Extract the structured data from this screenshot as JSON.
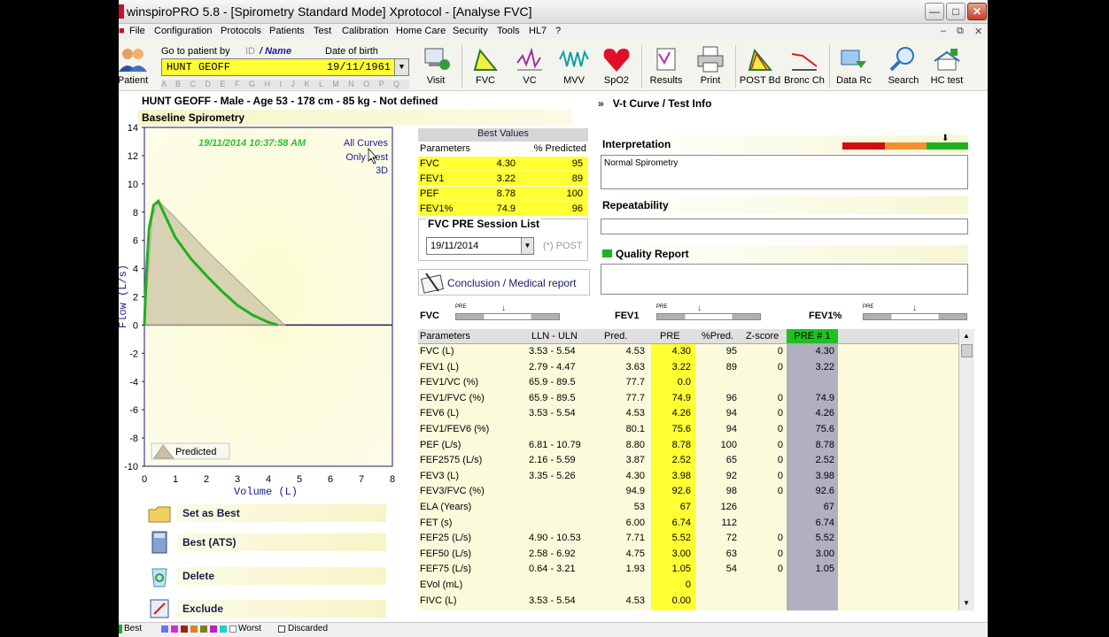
{
  "window": {
    "title": "winspiroPRO 5.8 - [Spirometry Standard Mode] Xprotocol - [Analyse FVC]"
  },
  "menu": [
    "File",
    "Configuration",
    "Protocols",
    "Patients",
    "Test",
    "Calibration",
    "Home Care",
    "Security",
    "Tools",
    "HL7",
    "?"
  ],
  "toolbar": {
    "patient_label": "Patient",
    "goto_label": "Go to patient by",
    "id_label": "ID",
    "name_label": "/ Name",
    "dob_label": "Date of birth",
    "patient_name": "HUNT GEOFF",
    "patient_dob": "19/11/1961",
    "alphabet": "A B C D E F G H I J K L M N O P Q R S T U V W X Y Z",
    "buttons": [
      "Visit",
      "FVC",
      "VC",
      "MVV",
      "SpO2",
      "Results",
      "Print",
      "POST Bd",
      "Bronc Ch",
      "Data Rc",
      "Search",
      "HC test"
    ]
  },
  "patient": {
    "info": "HUNT GEOFF - Male - Age 53 - 178 cm - 85 kg - Not defined",
    "test_title": "Baseline Spirometry"
  },
  "chart_data": {
    "type": "line",
    "xlabel": "Volume (L)",
    "ylabel": "Flow (L/s)",
    "xlim": [
      0,
      8
    ],
    "ylim": [
      -10,
      14
    ],
    "x_ticks": [
      "0",
      "1",
      "2",
      "3",
      "4",
      "5",
      "6",
      "7",
      "8"
    ],
    "y_ticks": [
      "14",
      "12",
      "10",
      "8",
      "6",
      "4",
      "2",
      "0",
      "-2",
      "-4",
      "-6",
      "-8",
      "-10"
    ],
    "timestamp": "19/11/2014 10:37:58 AM",
    "links": [
      "All Curves",
      "Only Best",
      "3D"
    ],
    "legend_predicted": "Predicted",
    "series": [
      {
        "name": "Predicted",
        "x": [
          0,
          0.25,
          0.45,
          1.0,
          2.0,
          3.0,
          4.0,
          4.53
        ],
        "y": [
          0,
          7.6,
          8.8,
          7.6,
          5.3,
          3.2,
          1.1,
          0
        ]
      },
      {
        "name": "Best",
        "x": [
          0,
          0.06,
          0.15,
          0.3,
          0.45,
          0.7,
          1.0,
          1.5,
          2.0,
          2.5,
          3.0,
          3.5,
          4.0,
          4.3
        ],
        "y": [
          0,
          3.5,
          6.8,
          8.5,
          8.78,
          7.6,
          6.2,
          4.7,
          3.5,
          2.4,
          1.4,
          0.7,
          0.2,
          0
        ]
      }
    ]
  },
  "actions": [
    "Set as Best",
    "Best (ATS)",
    "Delete",
    "Exclude"
  ],
  "best_values": {
    "title": "Best Values",
    "col_param": "Parameters",
    "col_pred": "% Predicted",
    "rows": [
      {
        "name": "FVC",
        "value": "4.30",
        "pct": "95"
      },
      {
        "name": "FEV1",
        "value": "3.22",
        "pct": "89"
      },
      {
        "name": "PEF",
        "value": "8.78",
        "pct": "100"
      },
      {
        "name": "FEV1%",
        "value": "74.9",
        "pct": "96"
      }
    ]
  },
  "session": {
    "title": "FVC PRE Session List",
    "date": "19/11/2014",
    "post": "(*) POST"
  },
  "conclusion_label": "Conclusion / Medical report",
  "sliders": [
    {
      "label": "FVC",
      "pre": "PRE"
    },
    {
      "label": "FEV1",
      "pre": "PRE"
    },
    {
      "label": "FEV1%",
      "pre": "PRE"
    }
  ],
  "right_panel": {
    "vt_title": "V-t Curve / Test Info",
    "interpretation_label": "Interpretation",
    "interpretation_text": "Normal Spirometry",
    "repeatability_label": "Repeatability",
    "quality_label": "Quality Report",
    "colors": {
      "red": "#d01010",
      "orange": "#f09030",
      "green": "#20b020"
    }
  },
  "params_table": {
    "headers": [
      "Parameters",
      "LLN - ULN",
      "Pred.",
      "PRE",
      "%Pred.",
      "Z-score",
      "PRE # 1"
    ],
    "rows": [
      [
        "FVC (L)",
        "3.53 - 5.54",
        "4.53",
        "4.30",
        "95",
        "0",
        "4.30"
      ],
      [
        "FEV1 (L)",
        "2.79 - 4.47",
        "3.63",
        "3.22",
        "89",
        "0",
        "3.22"
      ],
      [
        "FEV1/VC (%)",
        "65.9 - 89.5",
        "77.7",
        "0.0",
        "",
        "",
        ""
      ],
      [
        "FEV1/FVC (%)",
        "65.9 - 89.5",
        "77.7",
        "74.9",
        "96",
        "0",
        "74.9"
      ],
      [
        "FEV6 (L)",
        "3.53 - 5.54",
        "4.53",
        "4.26",
        "94",
        "0",
        "4.26"
      ],
      [
        "FEV1/FEV6 (%)",
        "",
        "80.1",
        "75.6",
        "94",
        "0",
        "75.6"
      ],
      [
        "PEF (L/s)",
        "6.81 - 10.79",
        "8.80",
        "8.78",
        "100",
        "0",
        "8.78"
      ],
      [
        "FEF2575 (L/s)",
        "2.16 - 5.59",
        "3.87",
        "2.52",
        "65",
        "0",
        "2.52"
      ],
      [
        "FEV3 (L)",
        "3.35 - 5.26",
        "4.30",
        "3.98",
        "92",
        "0",
        "3.98"
      ],
      [
        "FEV3/FVC (%)",
        "",
        "94.9",
        "92.6",
        "98",
        "0",
        "92.6"
      ],
      [
        "ELA (Years)",
        "",
        "53",
        "67",
        "126",
        "",
        "67"
      ],
      [
        "FET (s)",
        "",
        "6.00",
        "6.74",
        "112",
        "",
        "6.74"
      ],
      [
        "FEF25 (L/s)",
        "4.90 - 10.53",
        "7.71",
        "5.52",
        "72",
        "0",
        "5.52"
      ],
      [
        "FEF50 (L/s)",
        "2.58 - 6.92",
        "4.75",
        "3.00",
        "63",
        "0",
        "3.00"
      ],
      [
        "FEF75 (L/s)",
        "0.64 - 3.21",
        "1.93",
        "1.05",
        "54",
        "0",
        "1.05"
      ],
      [
        "EVol (mL)",
        "",
        "",
        "0",
        "",
        "",
        ""
      ],
      [
        "FIVC (L)",
        "3.53 - 5.54",
        "4.53",
        "0.00",
        "",
        "",
        ""
      ]
    ]
  },
  "legend_bar": {
    "best": "Best",
    "worst": "Worst",
    "discarded": "Discarded"
  }
}
